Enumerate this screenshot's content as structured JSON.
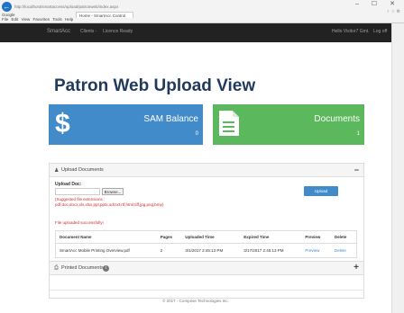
{
  "browser": {
    "back_glyph": "←",
    "address": "http://localhost/smartaccess/upload/patronweb/index.aspx",
    "tabs": [
      "Google",
      "Home - SmartAcc Control"
    ],
    "menu": [
      "File",
      "Edit",
      "View",
      "Favorites",
      "Tools",
      "Help"
    ],
    "window_controls": "– ☐ ✕",
    "address_right": "♀ ☆ ⚙"
  },
  "navbar": {
    "brand": "SmartAcc",
    "items": [
      "Clients -",
      "Licence Ready"
    ],
    "right_items": [
      "Hello Visitor7 Gmt.",
      "Log off"
    ]
  },
  "page": {
    "title": "Patron Web Upload View"
  },
  "stats": {
    "balance_icon": "$",
    "balance_label": "SAM Balance",
    "balance_value": "0",
    "documents_label": "Documents",
    "documents_value": "1"
  },
  "upload": {
    "panel_title": "Upload Documents",
    "panel_toggle": "−",
    "file_label": "Upload Doc:",
    "browse_label": "Browse...",
    "suggested_line1": "(Suggested file extensions :",
    "suggested_line2": "pdf,doc,docx,xls,xlsx,ppt,pptx,odt,txt,rtf,html,tiff,jpg,png,bmp)",
    "upload_button": "Upload",
    "success_message": "File uploaded successfully!",
    "columns": [
      "Document Name",
      "Pages",
      "Uploaded Time",
      "Expired Time",
      "Preview",
      "Delete"
    ],
    "rows": [
      {
        "name": "SmartAcc Mobile Printing Overview.pdf",
        "pages": "2",
        "uploaded": "3/1/2017 2:45:13 PM",
        "expired": "3/17/2017 2:45:13 PM",
        "preview": "Preview",
        "delete": "Delete"
      }
    ]
  },
  "printed": {
    "panel_title": "Printed Documents",
    "badge": "i",
    "toggle": "+"
  },
  "footer": {
    "text": "© 2017 - Comprise Technologies Inc."
  },
  "colors": {
    "navbar": "#222222",
    "title": "#1f3a5a",
    "blue": "#428bca",
    "green": "#5cb85c",
    "error_red": "#c9302c"
  }
}
